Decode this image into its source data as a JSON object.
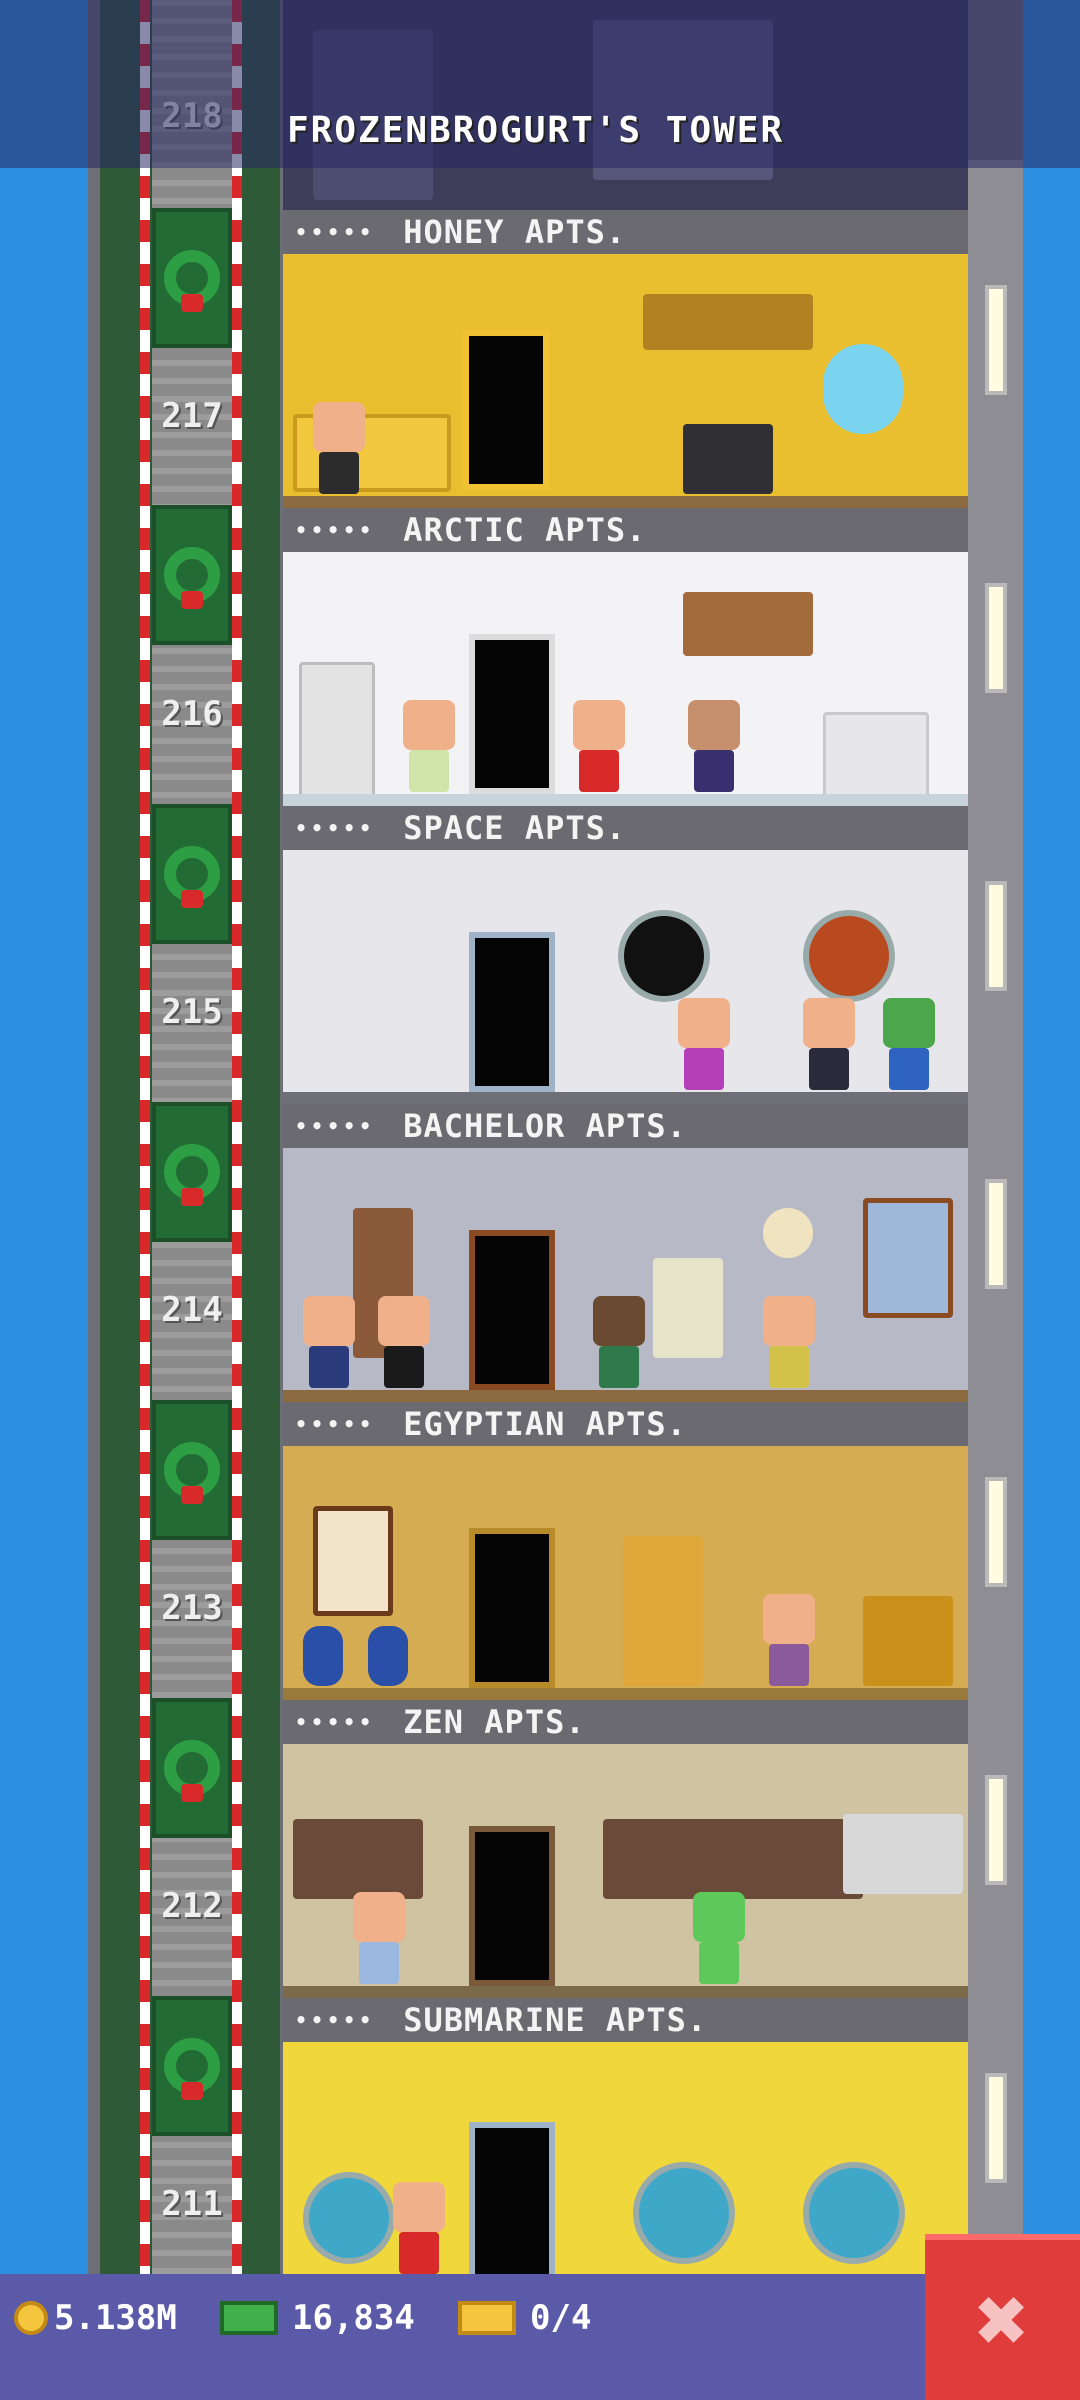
{
  "header": {
    "title": "FROZENBROGURT'S TOWER"
  },
  "floors": [
    {
      "number": "218",
      "name": "",
      "theme_color": "#3d3d5a"
    },
    {
      "number": "217",
      "name": "HONEY APTS.",
      "theme_color": "#e9bf30"
    },
    {
      "number": "216",
      "name": "ARCTIC APTS.",
      "theme_color": "#f3f3f6"
    },
    {
      "number": "215",
      "name": "SPACE APTS.",
      "theme_color": "#e7e7eb"
    },
    {
      "number": "214",
      "name": "BACHELOR APTS.",
      "theme_color": "#b7bac6"
    },
    {
      "number": "213",
      "name": "EGYPTIAN APTS.",
      "theme_color": "#d6ac52"
    },
    {
      "number": "212",
      "name": "ZEN APTS.",
      "theme_color": "#cfc3a1"
    },
    {
      "number": "211",
      "name": "SUBMARINE APTS.",
      "theme_color": "#f0d73b"
    }
  ],
  "stars": "•••••",
  "status": {
    "coins": "5.138M",
    "bux": "16,834",
    "tickets": "0/4"
  },
  "colors": {
    "sky": "#2d8fdf",
    "elevator_green": "#236b34",
    "close_red": "#e03c3c",
    "bottom_bar": "#5a5aa8"
  },
  "icons": {
    "coin": "coin-icon",
    "bux": "bux-icon",
    "ticket": "ticket-icon",
    "close": "close-icon"
  },
  "close_glyph": "✖"
}
